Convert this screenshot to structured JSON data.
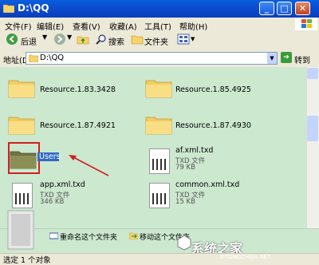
{
  "window": {
    "title": "D:\\QQ"
  },
  "menu": {
    "items": [
      "文件(F)",
      "编辑(E)",
      "查看(V)",
      "收藏(A)",
      "工具(T)",
      "帮助(H)"
    ]
  },
  "toolbar": {
    "back": "后退",
    "search": "搜索",
    "folders": "文件夹"
  },
  "address": {
    "label": "地址(D)",
    "value": "D:\\QQ",
    "go": "转到"
  },
  "files": [
    {
      "name": "Resource.1.83.3428"
    },
    {
      "name": "Resource.1.85.4925"
    },
    {
      "name": "Resource.1.87.4921"
    },
    {
      "name": "Resource.1.87.4930"
    },
    {
      "name": "Users"
    },
    {
      "name": "af.xml.txd",
      "type": "TXD 文件",
      "size": "79 KB"
    },
    {
      "name": "app.xml.txd",
      "type": "TXD 文件",
      "size": "346 KB"
    },
    {
      "name": "common.xml.txd",
      "type": "TXD 文件",
      "size": "15 KB"
    }
  ],
  "tasks": {
    "rename": "重命名这个文件夹",
    "move": "移动这个文件夹"
  },
  "status": {
    "text": "选定 1 个对象"
  },
  "watermark": {
    "text": "系统之家",
    "sub": "XITONGZHIJIA.NET"
  }
}
